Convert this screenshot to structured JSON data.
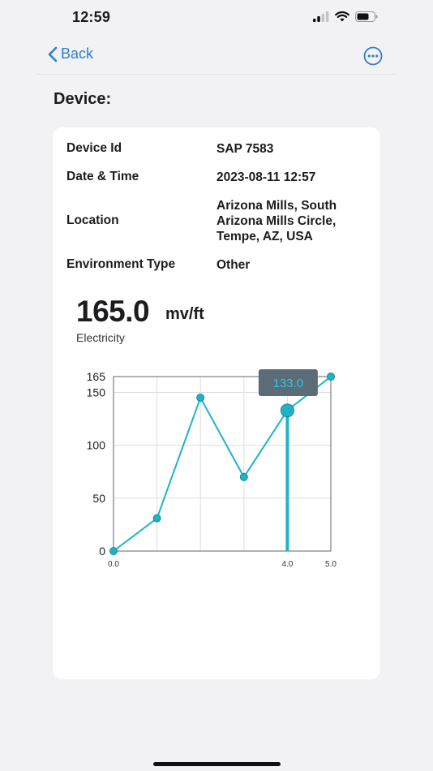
{
  "status": {
    "time": "12:59"
  },
  "nav": {
    "back_label": "Back"
  },
  "page": {
    "section_title": "Device:"
  },
  "device": {
    "id_label": "Device Id",
    "id_value": "SAP 7583",
    "datetime_label": "Date & Time",
    "datetime_value": "2023-08-11 12:57",
    "location_label": "Location",
    "location_lines": [
      "Arizona Mills, South",
      "Arizona Mills Circle,",
      "Tempe, AZ, USA"
    ],
    "env_label": "Environment Type",
    "env_value": "Other"
  },
  "reading": {
    "value": "165.0",
    "unit": "mv/ft",
    "label": "Electricity"
  },
  "chart_data": {
    "type": "line",
    "x": [
      0,
      1,
      2,
      3,
      4,
      5
    ],
    "values": [
      0,
      31,
      145,
      70,
      133,
      165
    ],
    "xlim": [
      0,
      5
    ],
    "ylim": [
      0,
      165
    ],
    "y_tick_labels": [
      "0",
      "50",
      "100",
      "150",
      "165"
    ],
    "y_ticks": [
      0,
      50,
      100,
      150,
      165
    ],
    "x_tick_labels": [
      "0.0",
      "4.0",
      "5.0"
    ],
    "x_ticks": [
      0,
      4,
      5
    ],
    "grid": true,
    "selected_index": 4,
    "tooltip": "133.0",
    "colors": {
      "line": "#1fb3c8",
      "point_stroke": "#17869a",
      "tooltip_bg": "#5b6b78",
      "tooltip_text": "#29c7e0",
      "grid": "#dddddd"
    }
  }
}
